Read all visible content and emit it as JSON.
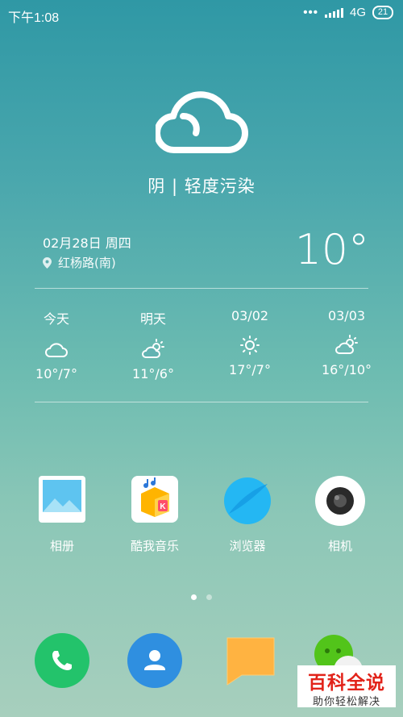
{
  "status_bar": {
    "time": "下午1:08",
    "signal_dots": "•••",
    "network": "4G",
    "battery": "21"
  },
  "weather": {
    "condition": "阴 | 轻度污染",
    "date": "02月28日 周四",
    "location": "红杨路(南)",
    "current_temp": "10°",
    "forecast": [
      {
        "day": "今天",
        "icon": "cloud-icon",
        "temp": "10°/7°"
      },
      {
        "day": "明天",
        "icon": "partly-sunny-icon",
        "temp": "11°/6°"
      },
      {
        "day": "03/02",
        "icon": "sun-icon",
        "temp": "17°/7°"
      },
      {
        "day": "03/03",
        "icon": "partly-sunny-icon",
        "temp": "16°/10°"
      }
    ]
  },
  "apps": [
    {
      "label": "相册",
      "icon": "gallery-icon"
    },
    {
      "label": "酷我音乐",
      "icon": "kuwo-music-icon"
    },
    {
      "label": "浏览器",
      "icon": "browser-icon"
    },
    {
      "label": "相机",
      "icon": "camera-icon"
    }
  ],
  "dock": [
    {
      "icon": "phone-icon",
      "color": "#23c36b"
    },
    {
      "icon": "contacts-icon",
      "color": "#2f8fe0"
    },
    {
      "icon": "messages-icon",
      "color": "#ffb341"
    },
    {
      "icon": "wechat-icon",
      "color": "#52c41a"
    }
  ],
  "watermark": {
    "title": "百科全说",
    "subtitle": "助你轻松解决"
  }
}
